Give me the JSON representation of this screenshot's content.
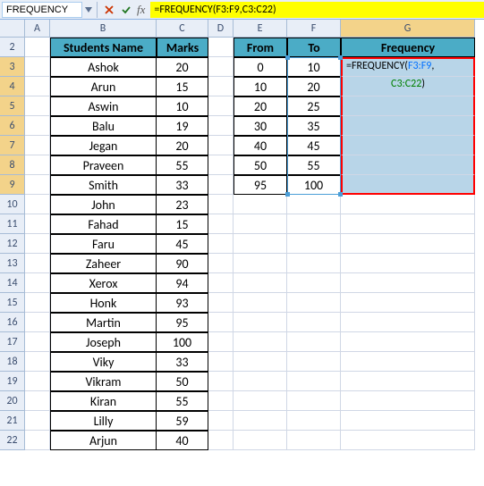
{
  "namebox": {
    "value": "FREQUENCY"
  },
  "formula_bar": {
    "value": "=FREQUENCY(F3:F9,C3:C22)"
  },
  "columns": [
    "A",
    "B",
    "C",
    "D",
    "E",
    "F",
    "G"
  ],
  "rows": [
    "2",
    "3",
    "4",
    "5",
    "6",
    "7",
    "8",
    "9",
    "10",
    "11",
    "12",
    "13",
    "14",
    "15",
    "16",
    "17",
    "18",
    "19",
    "20",
    "21",
    "22"
  ],
  "headers": {
    "b": "Students Name",
    "c": "Marks",
    "e": "From",
    "f": "To",
    "g": "Frequency"
  },
  "table1": [
    {
      "name": "Ashok",
      "marks": "20"
    },
    {
      "name": "Arun",
      "marks": "15"
    },
    {
      "name": "Aswin",
      "marks": "10"
    },
    {
      "name": "Balu",
      "marks": "19"
    },
    {
      "name": "Jegan",
      "marks": "20"
    },
    {
      "name": "Praveen",
      "marks": "55"
    },
    {
      "name": "Smith",
      "marks": "33"
    },
    {
      "name": "John",
      "marks": "23"
    },
    {
      "name": "Fahad",
      "marks": "15"
    },
    {
      "name": "Faru",
      "marks": "45"
    },
    {
      "name": "Zaheer",
      "marks": "90"
    },
    {
      "name": "Xerox",
      "marks": "94"
    },
    {
      "name": "Honk",
      "marks": "93"
    },
    {
      "name": "Martin",
      "marks": "95"
    },
    {
      "name": "Joseph",
      "marks": "100"
    },
    {
      "name": "Viky",
      "marks": "33"
    },
    {
      "name": "Vikram",
      "marks": "50"
    },
    {
      "name": "Kiran",
      "marks": "55"
    },
    {
      "name": "Lilly",
      "marks": "59"
    },
    {
      "name": "Arjun",
      "marks": "40"
    }
  ],
  "table2": [
    {
      "from": "0",
      "to": "10"
    },
    {
      "from": "10",
      "to": "20"
    },
    {
      "from": "20",
      "to": "25"
    },
    {
      "from": "30",
      "to": "35"
    },
    {
      "from": "40",
      "to": "45"
    },
    {
      "from": "50",
      "to": "55"
    },
    {
      "from": "95",
      "to": "100"
    }
  ],
  "formula_display": {
    "p1": "=FREQUENCY(",
    "p2": "F3:F9",
    "p3": ",",
    "p4": "C3:C22",
    "p5": ")"
  }
}
